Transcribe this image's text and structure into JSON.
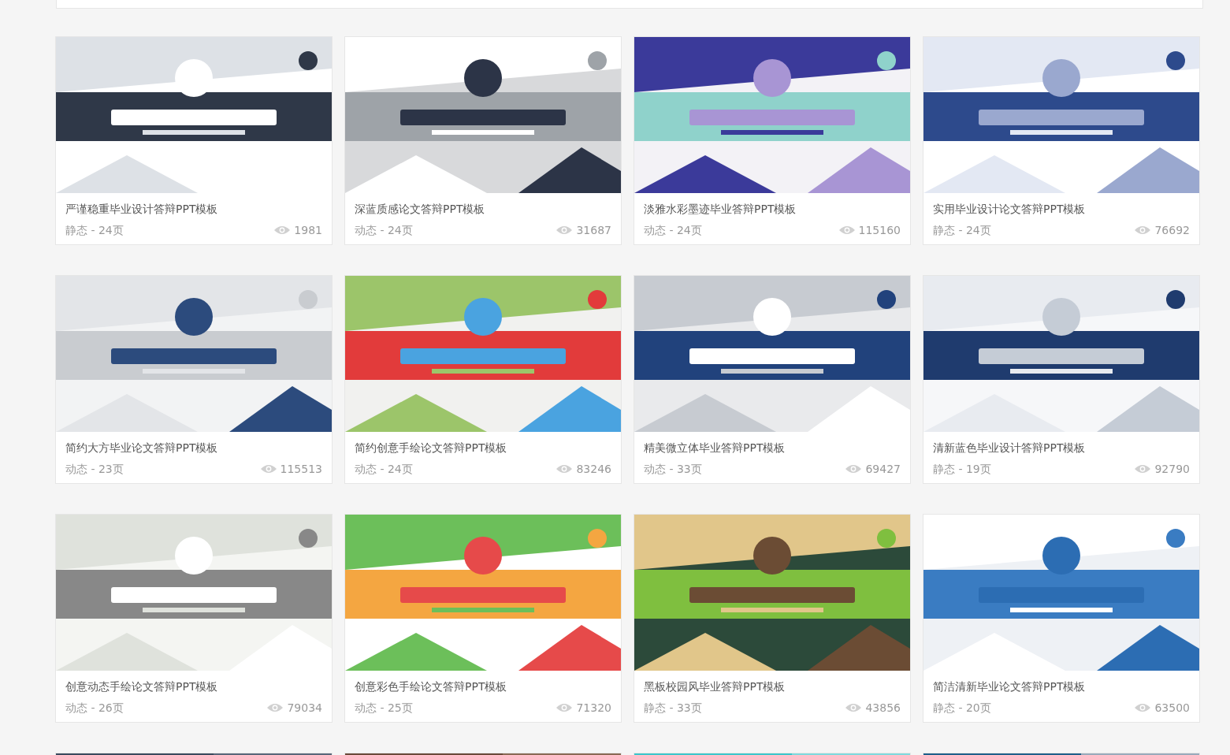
{
  "cards": [
    {
      "title": "严谨稳重毕业设计答辩PPT模板",
      "meta": "静态 - 24页",
      "views": "1981"
    },
    {
      "title": "深蓝质感论文答辩PPT模板",
      "meta": "动态 - 24页",
      "views": "31687"
    },
    {
      "title": "淡雅水彩墨迹毕业答辩PPT模板",
      "meta": "动态 - 24页",
      "views": "115160"
    },
    {
      "title": "实用毕业设计论文答辩PPT模板",
      "meta": "静态 - 24页",
      "views": "76692"
    },
    {
      "title": "简约大方毕业论文答辩PPT模板",
      "meta": "动态 - 23页",
      "views": "115513"
    },
    {
      "title": "简约创意手绘论文答辩PPT模板",
      "meta": "动态 - 24页",
      "views": "83246"
    },
    {
      "title": "精美微立体毕业答辩PPT模板",
      "meta": "动态 - 33页",
      "views": "69427"
    },
    {
      "title": "清新蓝色毕业设计答辩PPT模板",
      "meta": "静态 - 19页",
      "views": "92790"
    },
    {
      "title": "创意动态手绘论文答辩PPT模板",
      "meta": "动态 - 26页",
      "views": "79034"
    },
    {
      "title": "创意彩色手绘论文答辩PPT模板",
      "meta": "动态 - 25页",
      "views": "71320"
    },
    {
      "title": "黑板校园风毕业答辩PPT模板",
      "meta": "静态 - 33页",
      "views": "43856"
    },
    {
      "title": "简洁清新毕业论文答辩PPT模板",
      "meta": "静态 - 20页",
      "views": "63500"
    }
  ]
}
